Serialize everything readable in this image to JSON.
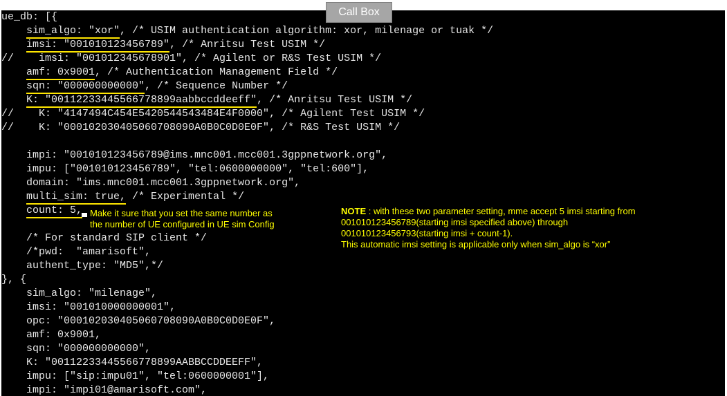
{
  "callbox_label": "Call Box",
  "lines": [
    {
      "pre": "ue_db: [{",
      "ul": "",
      "post": ""
    },
    {
      "pre": "    ",
      "ul": "sim_algo: \"xor\"",
      "post": ", /* USIM authentication algorithm: xor, milenage or tuak */"
    },
    {
      "pre": "    ",
      "ul": "imsi: \"001010123456789\"",
      "post": ", /* Anritsu Test USIM */"
    },
    {
      "pre": "//    imsi: \"001012345678901\", /* Agilent or R&S Test USIM */",
      "ul": "",
      "post": ""
    },
    {
      "pre": "    ",
      "ul": "amf: 0x9001",
      "post": ", /* Authentication Management Field */"
    },
    {
      "pre": "    ",
      "ul": "sqn: \"000000000000\"",
      "post": ", /* Sequence Number */"
    },
    {
      "pre": "    ",
      "ul": "K: \"00112233445566778899aabbccddeeff\"",
      "post": ", /* Anritsu Test USIM */"
    },
    {
      "pre": "//    K: \"4147494C454E5420544543484E4F0000\", /* Agilent Test USIM */",
      "ul": "",
      "post": ""
    },
    {
      "pre": "//    K: \"000102030405060708090A0B0C0D0E0F\", /* R&S Test USIM */",
      "ul": "",
      "post": ""
    },
    {
      "pre": "",
      "ul": "",
      "post": ""
    },
    {
      "pre": "    impi: \"001010123456789@ims.mnc001.mcc001.3gppnetwork.org\",",
      "ul": "",
      "post": ""
    },
    {
      "pre": "    impu: [\"001010123456789\", \"tel:0600000000\", \"tel:600\"],",
      "ul": "",
      "post": ""
    },
    {
      "pre": "    domain: \"ims.mnc001.mcc001.3gppnetwork.org\",",
      "ul": "",
      "post": ""
    },
    {
      "pre": "    ",
      "ul": "multi_sim: true,",
      "post": " /* Experimental */"
    },
    {
      "pre": "    ",
      "ul": "count: 5,",
      "post": ""
    },
    {
      "pre": "",
      "ul": "",
      "post": ""
    },
    {
      "pre": "    /* For standard SIP client */",
      "ul": "",
      "post": ""
    },
    {
      "pre": "    /*pwd:  \"amarisoft\",",
      "ul": "",
      "post": ""
    },
    {
      "pre": "    authent_type: \"MD5\",*/",
      "ul": "",
      "post": ""
    },
    {
      "pre": "}, {",
      "ul": "",
      "post": ""
    },
    {
      "pre": "    sim_algo: \"milenage\",",
      "ul": "",
      "post": ""
    },
    {
      "pre": "    imsi: \"001010000000001\",",
      "ul": "",
      "post": ""
    },
    {
      "pre": "    opc: \"000102030405060708090A0B0C0D0E0F\",",
      "ul": "",
      "post": ""
    },
    {
      "pre": "    amf: 0x9001,",
      "ul": "",
      "post": ""
    },
    {
      "pre": "    sqn: \"000000000000\",",
      "ul": "",
      "post": ""
    },
    {
      "pre": "    K: \"00112233445566778899AABBCCDDEEFF\",",
      "ul": "",
      "post": ""
    },
    {
      "pre": "    impu: [\"sip:impu01\", \"tel:0600000001\"],",
      "ul": "",
      "post": ""
    },
    {
      "pre": "    impi: \"impi01@amarisoft.com\",",
      "ul": "",
      "post": ""
    }
  ],
  "annotation_count": "Make it sure that you set the same number as\nthe number of UE configured in UE sim Config",
  "note": {
    "label": "NOTE",
    "text": " : with these two parameter setting, mme accept 5 imsi starting from\n001010123456789(starting imsi specified above) through\n001010123456793(starting imsi + count-1).\nThis automatic imsi setting is applicable only when sim_algo is “xor”"
  },
  "colors": {
    "annotation": "#ffff00",
    "underline": "#ffe600",
    "background": "#000000"
  }
}
